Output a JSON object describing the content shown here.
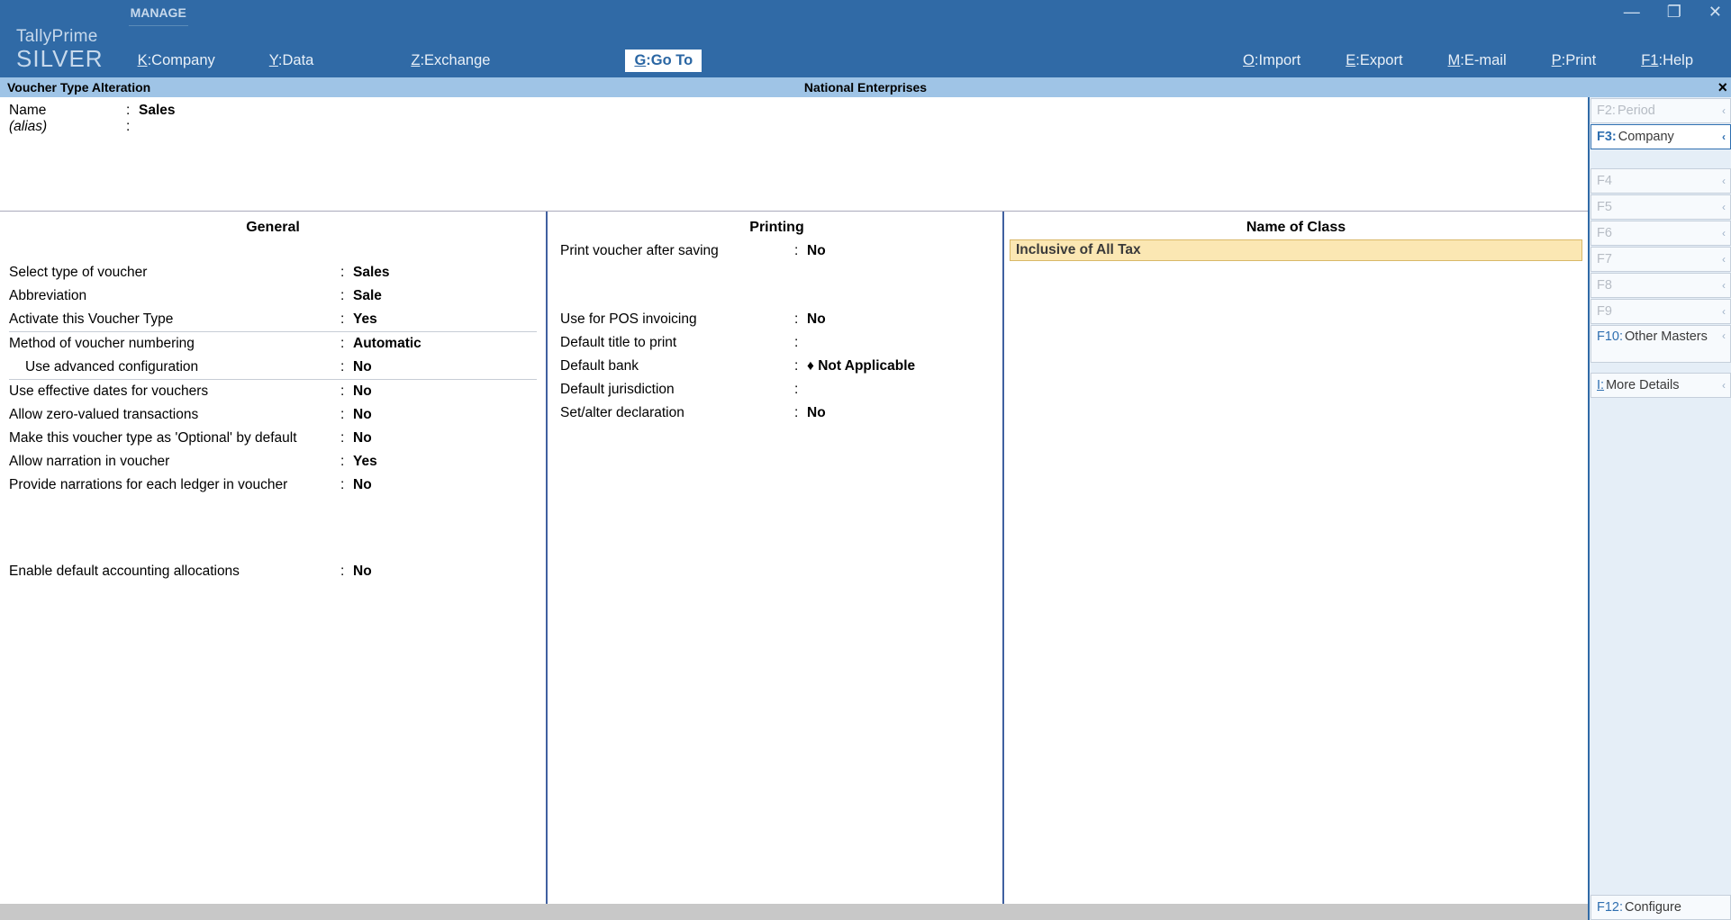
{
  "window_controls": {
    "minimize": "—",
    "maximize": "❐",
    "close": "✕"
  },
  "brand": {
    "name": "TallyPrime",
    "edition": "SILVER",
    "manage": "MANAGE"
  },
  "menu": {
    "company": "Company",
    "data": "Data",
    "exchange": "Exchange",
    "goto": "Go To",
    "import": "Import",
    "export": "Export",
    "email": "E-mail",
    "print": "Print",
    "help": "Help"
  },
  "subheader": {
    "title": "Voucher Type Alteration",
    "company": "National Enterprises"
  },
  "name_block": {
    "name_label": "Name",
    "name_value": "Sales",
    "alias_label": "(alias)"
  },
  "general": {
    "header": "General",
    "rows": {
      "select_type": {
        "lbl": "Select type of voucher",
        "val": "Sales"
      },
      "abbrev": {
        "lbl": "Abbreviation",
        "val": "Sale"
      },
      "activate": {
        "lbl": "Activate this Voucher Type",
        "val": "Yes"
      },
      "method": {
        "lbl": "Method of voucher numbering",
        "val": "Automatic"
      },
      "advanced": {
        "lbl": "Use advanced configuration",
        "val": "No"
      },
      "eff_dates": {
        "lbl": "Use effective dates for vouchers",
        "val": "No"
      },
      "zero_val": {
        "lbl": "Allow zero-valued transactions",
        "val": "No"
      },
      "optional": {
        "lbl": "Make this voucher type as 'Optional' by default",
        "val": "No"
      },
      "narration": {
        "lbl": "Allow narration in voucher",
        "val": "Yes"
      },
      "ledger_narr": {
        "lbl": "Provide narrations for each ledger in voucher",
        "val": "No"
      },
      "default_alloc": {
        "lbl": "Enable default accounting allocations",
        "val": "No"
      }
    }
  },
  "printing": {
    "header": "Printing",
    "rows": {
      "after_save": {
        "lbl": "Print voucher after saving",
        "val": "No"
      },
      "pos": {
        "lbl": "Use for POS invoicing",
        "val": "No"
      },
      "title": {
        "lbl": "Default title to print",
        "val": ""
      },
      "bank": {
        "lbl": "Default bank",
        "val": "♦ Not Applicable"
      },
      "jurisdiction": {
        "lbl": "Default jurisdiction",
        "val": ""
      },
      "declaration": {
        "lbl": "Set/alter declaration",
        "val": "No"
      }
    }
  },
  "class": {
    "header": "Name of Class",
    "value": "Inclusive of All Tax"
  },
  "right_panel": {
    "f2": {
      "key": "F2:",
      "txt": "Period"
    },
    "f3": {
      "key": "F3:",
      "txt": "Company"
    },
    "f4": {
      "key": "F4",
      "txt": ""
    },
    "f5": {
      "key": "F5",
      "txt": ""
    },
    "f6": {
      "key": "F6",
      "txt": ""
    },
    "f7": {
      "key": "F7",
      "txt": ""
    },
    "f8": {
      "key": "F8",
      "txt": ""
    },
    "f9": {
      "key": "F9",
      "txt": ""
    },
    "f10": {
      "key": "F10:",
      "txt": "Other Masters"
    },
    "more": {
      "key": "I:",
      "txt": "More Details"
    },
    "f12": {
      "key": "F12:",
      "txt": "Configure"
    }
  }
}
